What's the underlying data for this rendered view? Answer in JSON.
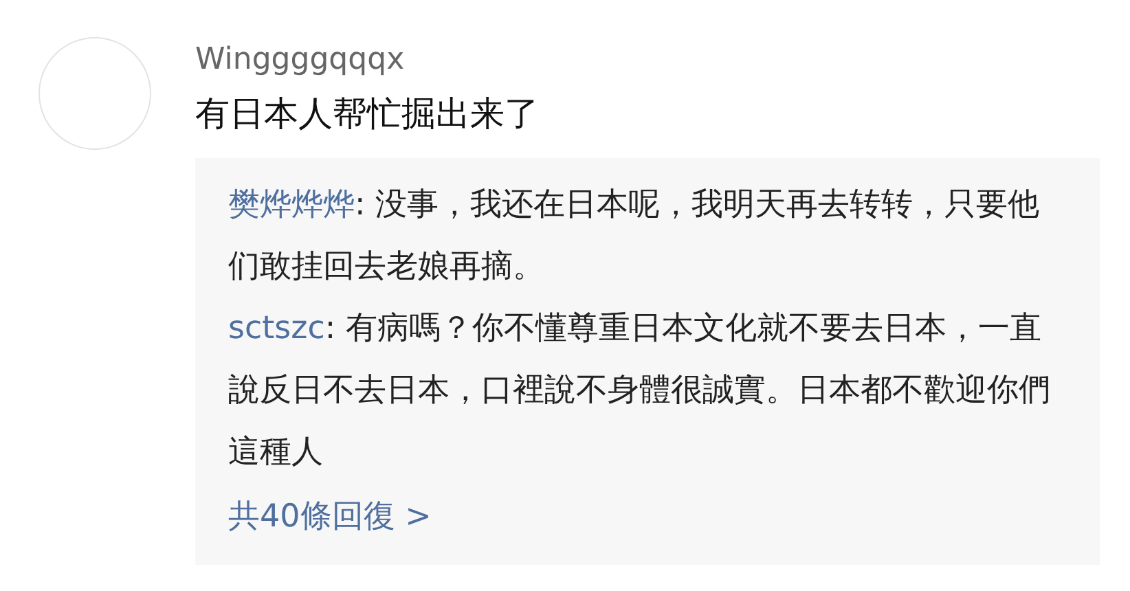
{
  "comment": {
    "username": "Winggggqqqx",
    "text": "有日本人帮忙掘出来了"
  },
  "replies": [
    {
      "author": "樊烨烨烨",
      "text": ": 没事，我还在日本呢，我明天再去转转，只要他们敢挂回去老娘再摘。"
    },
    {
      "author": "sctszc",
      "text": ": 有病嗎？你不懂尊重日本文化就不要去日本，一直說反日不去日本，口裡說不身體很誠實。日本都不歡迎你們這種人"
    }
  ],
  "more_replies": "共40條回復 >"
}
